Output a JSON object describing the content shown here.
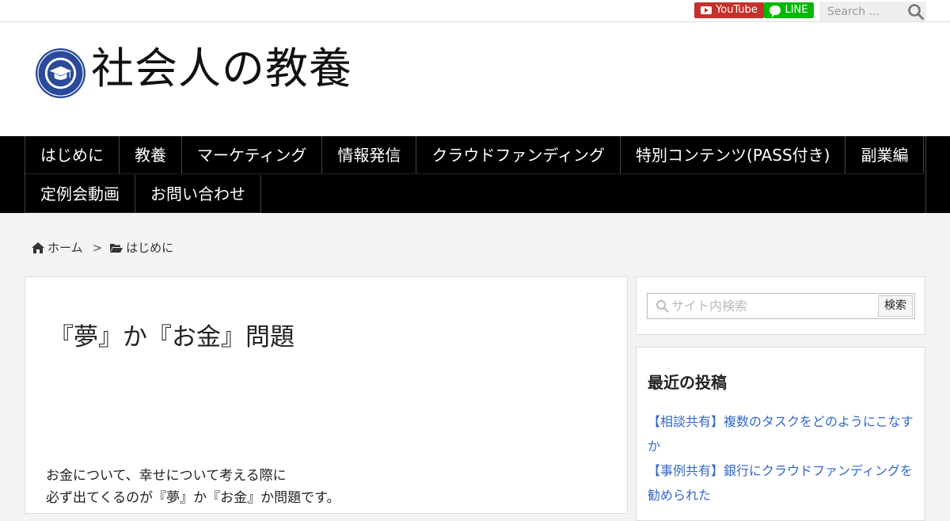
{
  "topbar": {
    "youtube_label": "YouTube",
    "line_label": "LINE",
    "search_placeholder": "Search …"
  },
  "header": {
    "site_title": "社会人の教養",
    "logo_ring_text": "社会人の教養"
  },
  "nav": {
    "items": [
      "はじめに",
      "教養",
      "マーケティング",
      "情報発信",
      "クラウドファンディング",
      "特別コンテンツ(PASS付き)",
      "副業編",
      "定例会動画",
      "お問い合わせ"
    ]
  },
  "breadcrumb": {
    "home": "ホーム",
    "separator": ">",
    "category": "はじめに"
  },
  "article": {
    "title": "『夢』か『お金』問題",
    "lines": [
      "お金について、幸せについて考える際に",
      "必ず出てくるのが『夢』か『お金』か問題です。"
    ]
  },
  "sidebar": {
    "search_placeholder": "サイト内検索",
    "search_button": "検索",
    "recent_title": "最近の投稿",
    "recent_posts": [
      "【相談共有】複数のタスクをどのようにこなすか",
      "【事例共有】銀行にクラウドファンディングを勧められた"
    ]
  },
  "colors": {
    "youtube": "#c4302b",
    "line": "#00b900",
    "nav_bg": "#000000",
    "link": "#3366cc",
    "logo_blue": "#2b4a9a"
  }
}
